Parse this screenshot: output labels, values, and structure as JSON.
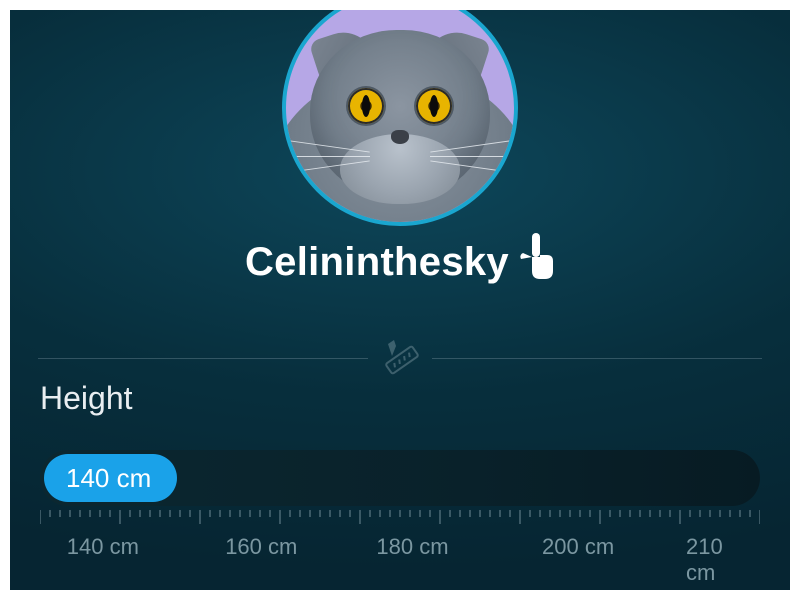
{
  "profile": {
    "username": "Celininthesky",
    "avatar_kind": "cat"
  },
  "icons": {
    "edit": "pointing-hand",
    "section": "ruler"
  },
  "height": {
    "label": "Height",
    "value": "140 cm",
    "scale_ticks": [
      "140 cm",
      "160 cm",
      "180 cm",
      "200 cm",
      "210 cm"
    ],
    "scale_positions_pct": [
      4,
      26,
      47,
      70,
      90
    ]
  },
  "colors": {
    "accent": "#1aa2e9",
    "ring": "#1aa6cf",
    "bg": "#0c3a4a"
  }
}
